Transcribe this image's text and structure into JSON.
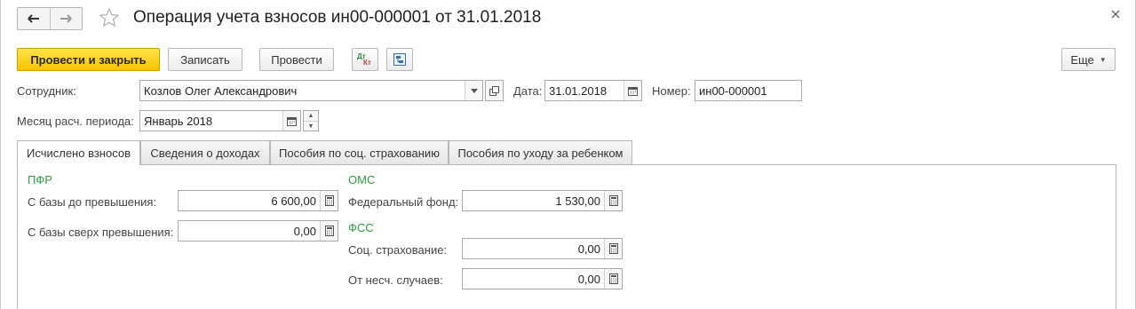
{
  "window": {
    "title": "Операция учета взносов ин00-000001 от 31.01.2018"
  },
  "toolbar": {
    "post_close_label": "Провести и закрыть",
    "save_label": "Записать",
    "post_label": "Провести",
    "dt_kt_top": "Дт",
    "dt_kt_bottom": "Кт",
    "more_label": "Еще"
  },
  "header": {
    "employee_label": "Сотрудник:",
    "employee_value": "Козлов Олег Александрович",
    "date_label": "Дата:",
    "date_value": "31.01.2018",
    "number_label": "Номер:",
    "number_value": "ин00-000001",
    "period_label": "Месяц расч. периода:",
    "period_value": "Январь 2018"
  },
  "tabs": [
    {
      "label": "Исчислено взносов",
      "active": true
    },
    {
      "label": "Сведения о доходах",
      "active": false
    },
    {
      "label": "Пособия по соц. страхованию",
      "active": false
    },
    {
      "label": "Пособия по уходу за ребенком",
      "active": false
    }
  ],
  "contributions": {
    "pfr": {
      "title": "ПФР",
      "base_below_label": "С базы до превышения:",
      "base_below_value": "6 600,00",
      "base_above_label": "С базы сверх превышения:",
      "base_above_value": "0,00"
    },
    "oms": {
      "title": "ОМС",
      "federal_label": "Федеральный фонд:",
      "federal_value": "1 530,00"
    },
    "fss": {
      "title": "ФСС",
      "social_label": "Соц. страхование:",
      "social_value": "0,00",
      "accident_label": "От несч. случаев:",
      "accident_value": "0,00"
    }
  },
  "colors": {
    "primary_button": "#f6c300",
    "section_title": "#2f9a41",
    "border": "#a9a9a9"
  }
}
